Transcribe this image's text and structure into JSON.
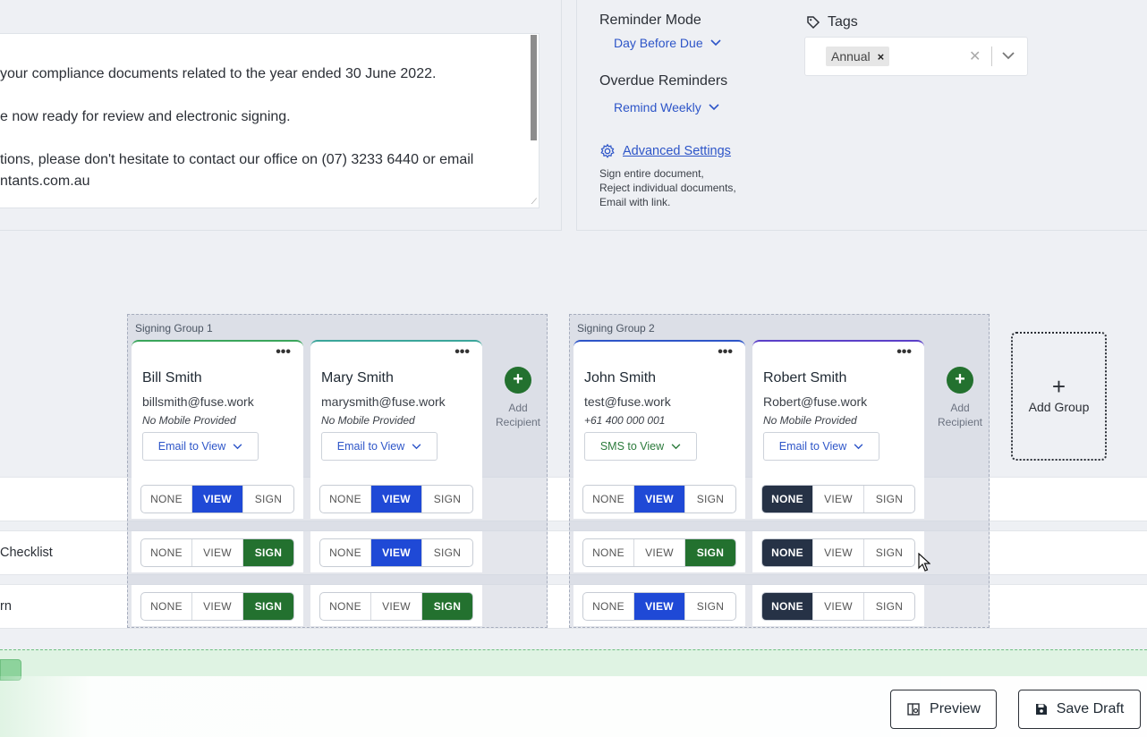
{
  "email": {
    "lines": [
      "your compliance documents related to the year ended 30 June 2022.",
      "e now ready for review and electronic signing.",
      "tions, please don't hesitate to contact our office on (07) 3233 6440 or email",
      "ntants.com.au"
    ]
  },
  "settings": {
    "reminder_mode_label": "Reminder Mode",
    "reminder_mode_value": "Day Before Due",
    "overdue_label": "Overdue Reminders",
    "overdue_value": "Remind Weekly",
    "advanced_label": "Advanced Settings",
    "advanced_desc": [
      "Sign entire document,",
      "Reject individual documents,",
      "Email with link."
    ],
    "tags_label": "Tags",
    "tags": [
      "Annual"
    ]
  },
  "rows": {
    "labels": [
      "",
      "Checklist",
      "rn"
    ]
  },
  "groups": [
    {
      "title": "Signing Group 1",
      "recipients": [
        {
          "name": "Bill Smith",
          "email": "billsmith@fuse.work",
          "mobile": "No Mobile Provided",
          "delivery": "Email to View",
          "accent": "#3aa55b",
          "selections": [
            "VIEW",
            "SIGN",
            "SIGN"
          ]
        },
        {
          "name": "Mary Smith",
          "email": "marysmith@fuse.work",
          "mobile": "No Mobile Provided",
          "delivery": "Email to View",
          "accent": "#3aa59a",
          "selections": [
            "VIEW",
            "VIEW",
            "SIGN"
          ]
        }
      ]
    },
    {
      "title": "Signing Group 2",
      "recipients": [
        {
          "name": "John Smith",
          "email": "test@fuse.work",
          "mobile": "+61 400 000 001",
          "delivery": "SMS to View",
          "accent": "#2d55c8",
          "selections": [
            "VIEW",
            "SIGN",
            "VIEW"
          ]
        },
        {
          "name": "Robert Smith",
          "email": "Robert@fuse.work",
          "mobile": "No Mobile Provided",
          "delivery": "Email to View",
          "accent": "#5b3fc8",
          "selections": [
            "NONE",
            "NONE",
            "NONE"
          ]
        }
      ]
    }
  ],
  "segment_options": [
    "NONE",
    "VIEW",
    "SIGN"
  ],
  "add_recipient_label": [
    "Add",
    "Recipient"
  ],
  "add_group_label": "Add Group",
  "footer": {
    "preview_label": "Preview",
    "save_label": "Save Draft"
  }
}
